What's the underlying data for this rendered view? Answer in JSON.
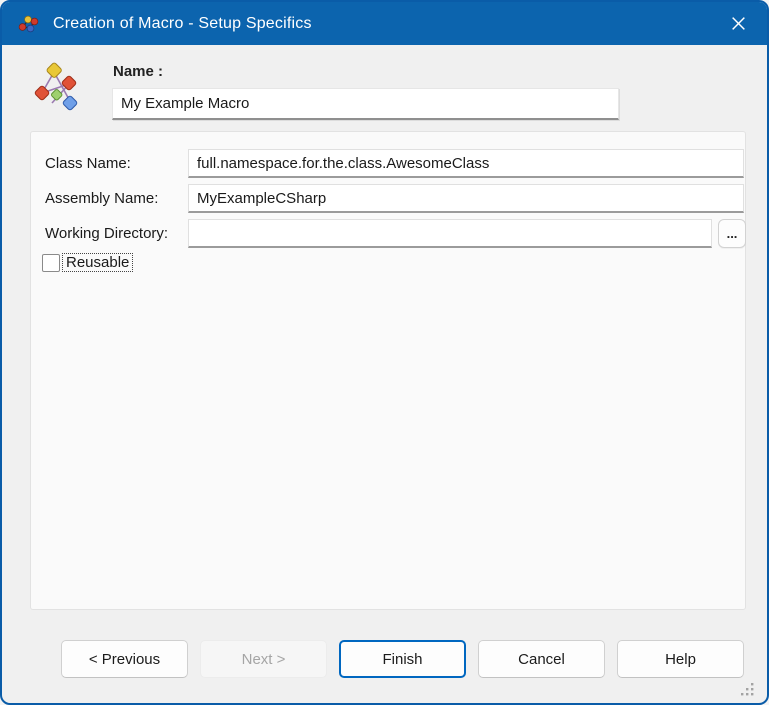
{
  "window": {
    "title": "Creation of Macro - Setup Specifics"
  },
  "colors": {
    "titlebar_blue": "#0c64ae",
    "window_border_blue": "#0a5ca8",
    "accent_blue": "#0067c0",
    "window_bg": "#f0f0f0",
    "panel_bg": "#fafafa",
    "input_bottom_border": "#8f8f8f",
    "disabled_text": "#a5a5a5"
  },
  "icons": {
    "app": "macro-molecule-icon",
    "header": "macro-diamonds-icon",
    "close": "close-x-icon",
    "browse": "ellipsis-icon",
    "resize": "resize-grip"
  },
  "header": {
    "name_label": "Name :",
    "name_value": "My Example Macro"
  },
  "form": {
    "class_name": {
      "label": "Class Name:",
      "value": "full.namespace.for.the.class.AwesomeClass"
    },
    "assembly_name": {
      "label": "Assembly Name:",
      "value": "MyExampleCSharp"
    },
    "working_directory": {
      "label": "Working Directory:",
      "value": "",
      "browse_label": "..."
    },
    "reusable": {
      "label": "Reusable",
      "checked": false
    }
  },
  "buttons": {
    "previous": "< Previous",
    "next": "Next >",
    "next_enabled": false,
    "finish": "Finish",
    "cancel": "Cancel",
    "help": "Help"
  }
}
